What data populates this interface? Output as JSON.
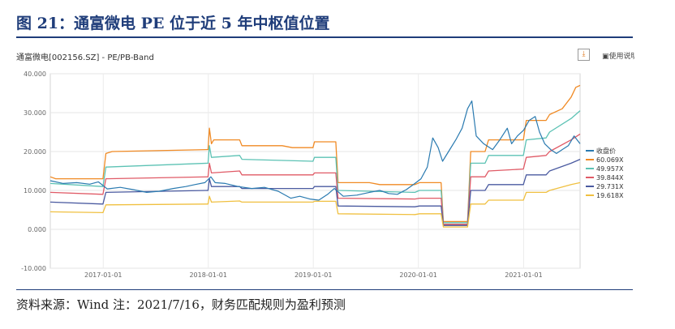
{
  "header": {
    "figure_title": "图 21：通富微电 PE 位于近 5 年中枢值位置"
  },
  "panel": {
    "title": "通富微电[002156.SZ] - PE/PB-Band",
    "download_icon": "download-icon",
    "help_label": "使用说明"
  },
  "footer": {
    "source": "资料来源：Wind 注：2021/7/16，财务匹配规则为盈利预测"
  },
  "chart_data": {
    "type": "line",
    "xlabel": "",
    "ylabel": "",
    "x_ticks": [
      "2017-01-01",
      "2018-01-01",
      "2019-01-01",
      "2020-01-01",
      "2021-01-01"
    ],
    "y_ticks": [
      "-10.000",
      "0.000",
      "10.000",
      "20.000",
      "30.000",
      "40.000"
    ],
    "ylim": [
      -10,
      40
    ],
    "xlim": [
      "2016-07-01",
      "2021-07-16"
    ],
    "grid": true,
    "legend_position": "right",
    "series": [
      {
        "name": "收盘价",
        "color": "#2a7ab0",
        "points": [
          [
            "2016-07-01",
            12.5
          ],
          [
            "2016-08-15",
            11.8
          ],
          [
            "2016-10-01",
            12.0
          ],
          [
            "2016-11-15",
            11.6
          ],
          [
            "2016-12-15",
            12.2
          ],
          [
            "2017-01-15",
            10.4
          ],
          [
            "2017-03-01",
            10.8
          ],
          [
            "2017-04-15",
            10.2
          ],
          [
            "2017-06-01",
            9.5
          ],
          [
            "2017-07-15",
            9.8
          ],
          [
            "2017-09-01",
            10.5
          ],
          [
            "2017-10-15",
            11.0
          ],
          [
            "2017-11-15",
            11.5
          ],
          [
            "2017-12-20",
            12.0
          ],
          [
            "2018-01-10",
            13.5
          ],
          [
            "2018-01-25",
            12.0
          ],
          [
            "2018-03-01",
            11.8
          ],
          [
            "2018-04-15",
            11.0
          ],
          [
            "2018-06-01",
            10.5
          ],
          [
            "2018-07-15",
            10.8
          ],
          [
            "2018-09-01",
            9.8
          ],
          [
            "2018-10-15",
            8.0
          ],
          [
            "2018-11-15",
            8.5
          ],
          [
            "2018-12-20",
            7.8
          ],
          [
            "2019-01-20",
            7.5
          ],
          [
            "2019-02-20",
            9.0
          ],
          [
            "2019-03-15",
            10.5
          ],
          [
            "2019-04-15",
            8.5
          ],
          [
            "2019-06-01",
            8.8
          ],
          [
            "2019-07-15",
            9.5
          ],
          [
            "2019-08-20",
            10.0
          ],
          [
            "2019-09-20",
            9.2
          ],
          [
            "2019-10-20",
            9.0
          ],
          [
            "2019-11-20",
            10.2
          ],
          [
            "2019-12-20",
            11.8
          ],
          [
            "2020-01-10",
            13.0
          ],
          [
            "2020-02-01",
            16.0
          ],
          [
            "2020-02-20",
            23.5
          ],
          [
            "2020-03-10",
            21.0
          ],
          [
            "2020-03-25",
            17.5
          ],
          [
            "2020-04-15",
            20.0
          ],
          [
            "2020-05-10",
            23.0
          ],
          [
            "2020-06-01",
            26.0
          ],
          [
            "2020-06-20",
            31.0
          ],
          [
            "2020-07-05",
            33.0
          ],
          [
            "2020-07-20",
            24.0
          ],
          [
            "2020-08-15",
            22.0
          ],
          [
            "2020-09-15",
            20.5
          ],
          [
            "2020-10-10",
            23.0
          ],
          [
            "2020-11-05",
            26.0
          ],
          [
            "2020-11-20",
            22.0
          ],
          [
            "2020-12-10",
            24.0
          ],
          [
            "2021-01-01",
            25.5
          ],
          [
            "2021-01-20",
            28.0
          ],
          [
            "2021-02-10",
            29.0
          ],
          [
            "2021-02-25",
            25.0
          ],
          [
            "2021-03-15",
            22.0
          ],
          [
            "2021-04-05",
            20.5
          ],
          [
            "2021-04-25",
            19.5
          ],
          [
            "2021-05-15",
            20.5
          ],
          [
            "2021-06-05",
            21.5
          ],
          [
            "2021-06-25",
            24.0
          ],
          [
            "2021-07-16",
            22.0
          ]
        ]
      },
      {
        "name": "60.069X",
        "color": "#f08a24",
        "points": [
          [
            "2016-07-01",
            13.5
          ],
          [
            "2016-07-20",
            13.0
          ],
          [
            "2016-12-31",
            13.0
          ],
          [
            "2017-01-10",
            19.5
          ],
          [
            "2017-02-01",
            20.0
          ],
          [
            "2017-12-31",
            20.5
          ],
          [
            "2018-01-05",
            26.0
          ],
          [
            "2018-01-12",
            22.0
          ],
          [
            "2018-01-20",
            23.0
          ],
          [
            "2018-04-20",
            23.0
          ],
          [
            "2018-04-28",
            21.5
          ],
          [
            "2018-09-15",
            21.5
          ],
          [
            "2018-10-20",
            21.0
          ],
          [
            "2018-12-31",
            21.0
          ],
          [
            "2019-01-05",
            22.5
          ],
          [
            "2019-03-20",
            22.5
          ],
          [
            "2019-03-28",
            12.0
          ],
          [
            "2019-07-15",
            12.0
          ],
          [
            "2019-08-20",
            11.5
          ],
          [
            "2019-12-20",
            11.5
          ],
          [
            "2020-01-05",
            12.0
          ],
          [
            "2020-03-20",
            12.0
          ],
          [
            "2020-03-28",
            2.0
          ],
          [
            "2020-06-20",
            2.0
          ],
          [
            "2020-07-01",
            20.0
          ],
          [
            "2020-08-20",
            20.0
          ],
          [
            "2020-09-01",
            23.0
          ],
          [
            "2020-12-31",
            23.0
          ],
          [
            "2021-01-10",
            28.0
          ],
          [
            "2021-03-20",
            28.0
          ],
          [
            "2021-04-01",
            29.5
          ],
          [
            "2021-05-15",
            31.0
          ],
          [
            "2021-06-15",
            34.0
          ],
          [
            "2021-07-01",
            36.5
          ],
          [
            "2021-07-16",
            37.0
          ]
        ]
      },
      {
        "name": "49.957X",
        "color": "#5cc2b4",
        "points": [
          [
            "2016-07-01",
            11.8
          ],
          [
            "2016-12-31",
            11.0
          ],
          [
            "2017-01-10",
            16.0
          ],
          [
            "2017-12-31",
            17.0
          ],
          [
            "2018-01-05",
            21.5
          ],
          [
            "2018-01-12",
            18.5
          ],
          [
            "2018-04-20",
            19.0
          ],
          [
            "2018-04-28",
            18.0
          ],
          [
            "2018-12-31",
            17.5
          ],
          [
            "2019-01-05",
            18.5
          ],
          [
            "2019-03-20",
            18.5
          ],
          [
            "2019-03-28",
            10.0
          ],
          [
            "2019-12-20",
            9.5
          ],
          [
            "2020-01-05",
            10.0
          ],
          [
            "2020-03-20",
            10.0
          ],
          [
            "2020-03-28",
            1.7
          ],
          [
            "2020-06-20",
            1.7
          ],
          [
            "2020-07-01",
            17.0
          ],
          [
            "2020-08-20",
            17.0
          ],
          [
            "2020-09-01",
            19.0
          ],
          [
            "2020-12-31",
            19.0
          ],
          [
            "2021-01-10",
            23.0
          ],
          [
            "2021-03-20",
            23.5
          ],
          [
            "2021-04-01",
            25.0
          ],
          [
            "2021-06-15",
            28.5
          ],
          [
            "2021-07-16",
            30.5
          ]
        ]
      },
      {
        "name": "39.844X",
        "color": "#e05a66",
        "points": [
          [
            "2016-07-01",
            9.5
          ],
          [
            "2016-12-31",
            9.0
          ],
          [
            "2017-01-10",
            13.0
          ],
          [
            "2017-12-31",
            13.5
          ],
          [
            "2018-01-05",
            17.0
          ],
          [
            "2018-01-12",
            14.5
          ],
          [
            "2018-04-20",
            15.0
          ],
          [
            "2018-04-28",
            14.0
          ],
          [
            "2018-12-31",
            14.0
          ],
          [
            "2019-01-05",
            14.5
          ],
          [
            "2019-03-20",
            14.5
          ],
          [
            "2019-03-28",
            8.0
          ],
          [
            "2019-12-20",
            7.8
          ],
          [
            "2020-01-05",
            8.0
          ],
          [
            "2020-03-20",
            8.0
          ],
          [
            "2020-03-28",
            1.3
          ],
          [
            "2020-06-20",
            1.3
          ],
          [
            "2020-07-01",
            13.5
          ],
          [
            "2020-08-20",
            13.5
          ],
          [
            "2020-09-01",
            15.0
          ],
          [
            "2020-12-31",
            15.5
          ],
          [
            "2021-01-10",
            18.5
          ],
          [
            "2021-03-20",
            19.0
          ],
          [
            "2021-04-01",
            20.0
          ],
          [
            "2021-06-15",
            23.0
          ],
          [
            "2021-07-16",
            24.5
          ]
        ]
      },
      {
        "name": "29.731X",
        "color": "#4a5aa0",
        "points": [
          [
            "2016-07-01",
            7.0
          ],
          [
            "2016-12-31",
            6.5
          ],
          [
            "2017-01-10",
            9.5
          ],
          [
            "2017-12-31",
            10.0
          ],
          [
            "2018-01-05",
            13.0
          ],
          [
            "2018-01-12",
            11.0
          ],
          [
            "2018-04-20",
            11.0
          ],
          [
            "2018-04-28",
            10.5
          ],
          [
            "2018-12-31",
            10.5
          ],
          [
            "2019-01-05",
            11.0
          ],
          [
            "2019-03-20",
            11.0
          ],
          [
            "2019-03-28",
            6.0
          ],
          [
            "2019-12-20",
            5.8
          ],
          [
            "2020-01-05",
            6.0
          ],
          [
            "2020-03-20",
            6.0
          ],
          [
            "2020-03-28",
            1.0
          ],
          [
            "2020-06-20",
            1.0
          ],
          [
            "2020-07-01",
            10.0
          ],
          [
            "2020-08-20",
            10.0
          ],
          [
            "2020-09-01",
            11.5
          ],
          [
            "2020-12-31",
            11.5
          ],
          [
            "2021-01-10",
            14.0
          ],
          [
            "2021-03-20",
            14.0
          ],
          [
            "2021-04-01",
            15.0
          ],
          [
            "2021-06-15",
            17.0
          ],
          [
            "2021-07-16",
            18.0
          ]
        ]
      },
      {
        "name": "19.618X",
        "color": "#f0c040",
        "points": [
          [
            "2016-07-01",
            4.5
          ],
          [
            "2016-12-31",
            4.3
          ],
          [
            "2017-01-10",
            6.3
          ],
          [
            "2017-12-31",
            6.5
          ],
          [
            "2018-01-05",
            8.5
          ],
          [
            "2018-01-12",
            7.0
          ],
          [
            "2018-04-20",
            7.3
          ],
          [
            "2018-04-28",
            7.0
          ],
          [
            "2018-12-31",
            7.0
          ],
          [
            "2019-01-05",
            7.2
          ],
          [
            "2019-03-20",
            7.2
          ],
          [
            "2019-03-28",
            4.0
          ],
          [
            "2019-12-20",
            3.8
          ],
          [
            "2020-01-05",
            4.0
          ],
          [
            "2020-03-20",
            4.0
          ],
          [
            "2020-03-28",
            0.6
          ],
          [
            "2020-06-20",
            0.6
          ],
          [
            "2020-07-01",
            6.5
          ],
          [
            "2020-08-20",
            6.5
          ],
          [
            "2020-09-01",
            7.5
          ],
          [
            "2020-12-31",
            7.5
          ],
          [
            "2021-01-10",
            9.5
          ],
          [
            "2021-03-20",
            9.5
          ],
          [
            "2021-04-01",
            10.0
          ],
          [
            "2021-06-15",
            11.5
          ],
          [
            "2021-07-16",
            12.0
          ]
        ]
      }
    ]
  }
}
